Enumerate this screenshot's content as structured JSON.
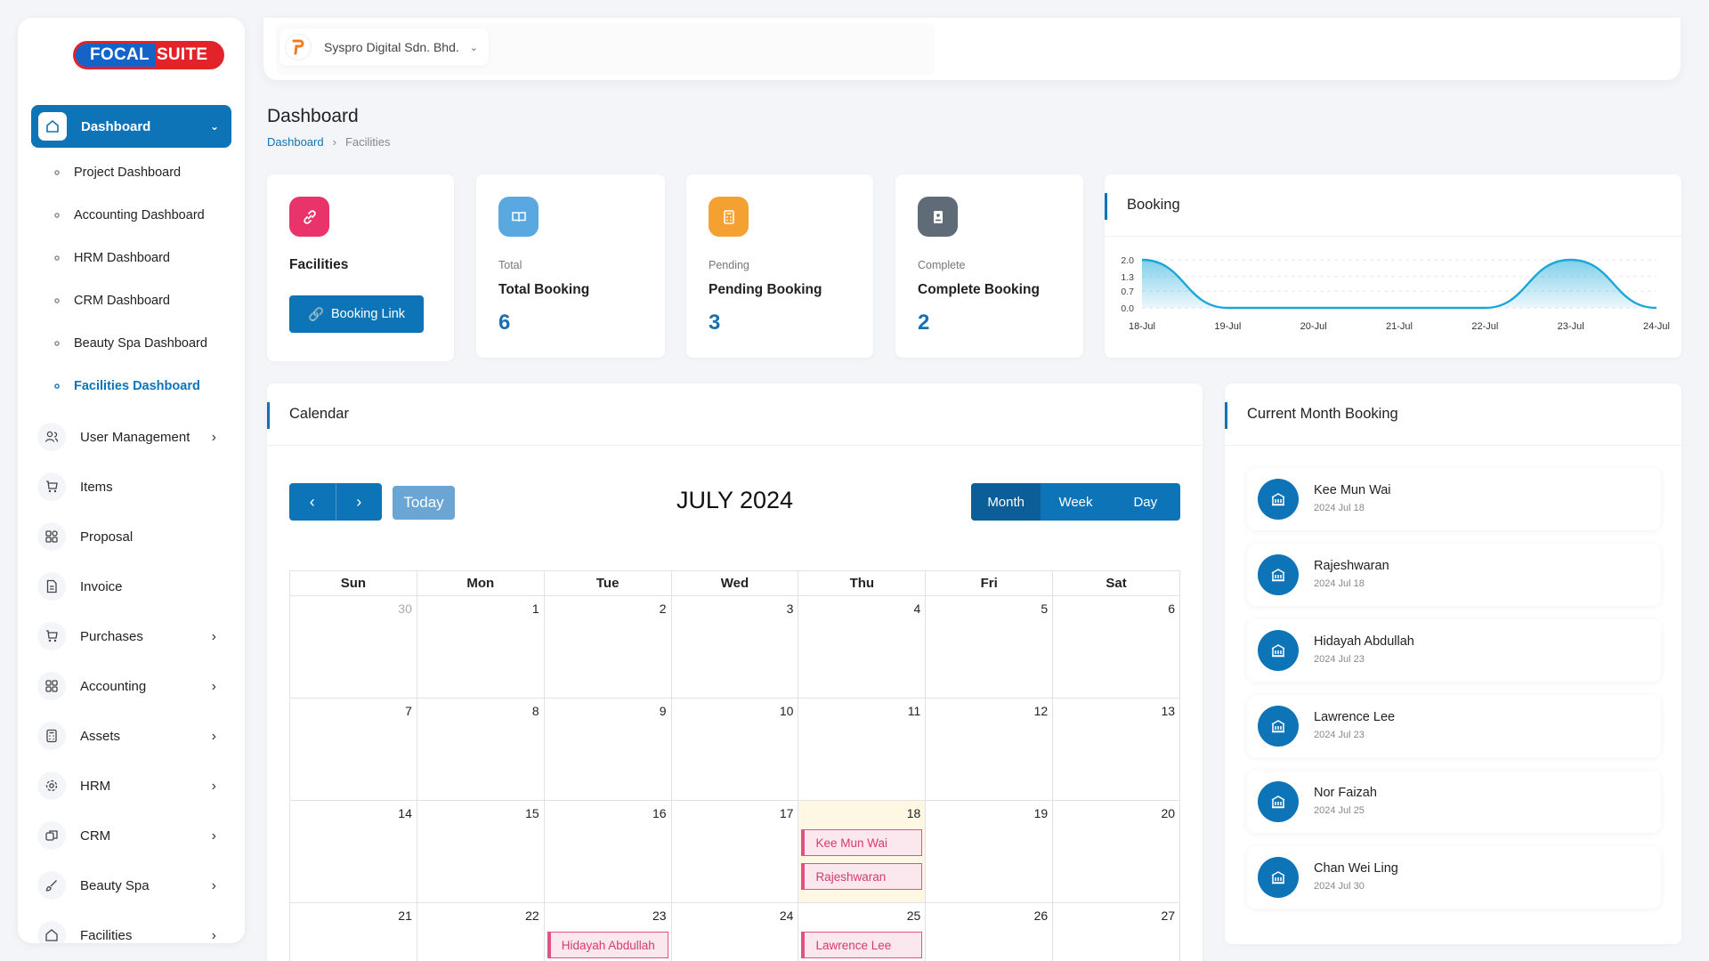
{
  "brand": {
    "logo_part1": "FOCAL",
    "logo_part2": "SUITE"
  },
  "sidebar": {
    "active": {
      "label": "Dashboard"
    },
    "subitems": [
      {
        "label": "Project Dashboard"
      },
      {
        "label": "Accounting Dashboard"
      },
      {
        "label": "HRM Dashboard"
      },
      {
        "label": "CRM Dashboard"
      },
      {
        "label": "Beauty Spa Dashboard"
      },
      {
        "label": "Facilities Dashboard"
      }
    ],
    "items": [
      {
        "label": "User Management",
        "icon": "users-icon"
      },
      {
        "label": "Items",
        "icon": "cart-icon"
      },
      {
        "label": "Proposal",
        "icon": "proposal-icon"
      },
      {
        "label": "Invoice",
        "icon": "invoice-icon"
      },
      {
        "label": "Purchases",
        "icon": "cart-icon"
      },
      {
        "label": "Accounting",
        "icon": "grid-icon"
      },
      {
        "label": "Assets",
        "icon": "calculator-icon"
      },
      {
        "label": "HRM",
        "icon": "hrm-icon"
      },
      {
        "label": "CRM",
        "icon": "crm-icon"
      },
      {
        "label": "Beauty Spa",
        "icon": "brush-icon"
      },
      {
        "label": "Facilities",
        "icon": "home-icon"
      }
    ]
  },
  "header": {
    "company": "Syspro Digital Sdn. Bhd."
  },
  "page": {
    "title": "Dashboard",
    "breadcrumb": [
      "Dashboard",
      "Facilities"
    ]
  },
  "stats": {
    "facilities": {
      "label": "Facilities",
      "button": "Booking Link",
      "color": "#e8336b"
    },
    "total": {
      "small": "Total",
      "label": "Total Booking",
      "value": "6",
      "color": "#5aa8e0"
    },
    "pending": {
      "small": "Pending",
      "label": "Pending Booking",
      "value": "3",
      "color": "#f4a132"
    },
    "complete": {
      "small": "Complete",
      "label": "Complete Booking",
      "value": "2",
      "color": "#5f6b76"
    }
  },
  "booking_chart": {
    "title": "Booking",
    "chart_data": {
      "type": "area",
      "x": [
        "18-Jul",
        "19-Jul",
        "20-Jul",
        "21-Jul",
        "22-Jul",
        "23-Jul",
        "24-Jul"
      ],
      "values": [
        2,
        0,
        0,
        0,
        0,
        2,
        0
      ],
      "yticks": [
        "2.0",
        "1.3",
        "0.7",
        "0.0"
      ],
      "ylim": [
        0,
        2
      ],
      "color": "#1aa7d8"
    }
  },
  "calendar": {
    "title": "Calendar",
    "month_title": "JULY 2024",
    "today_label": "Today",
    "views": [
      "Month",
      "Week",
      "Day"
    ],
    "weekdays": [
      "Sun",
      "Mon",
      "Tue",
      "Wed",
      "Thu",
      "Fri",
      "Sat"
    ],
    "weeks": [
      [
        "30",
        "1",
        "2",
        "3",
        "4",
        "5",
        "6"
      ],
      [
        "7",
        "8",
        "9",
        "10",
        "11",
        "12",
        "13"
      ],
      [
        "14",
        "15",
        "16",
        "17",
        "18",
        "19",
        "20"
      ],
      [
        "21",
        "22",
        "23",
        "24",
        "25",
        "26",
        "27"
      ]
    ],
    "events": [
      {
        "week": 2,
        "day": 4,
        "slot": 0,
        "title": "Kee Mun Wai"
      },
      {
        "week": 2,
        "day": 4,
        "slot": 1,
        "title": "Rajeshwaran"
      },
      {
        "week": 3,
        "day": 2,
        "slot": 0,
        "title": "Hidayah Abdullah"
      },
      {
        "week": 3,
        "day": 4,
        "slot": 0,
        "title": "Lawrence Lee"
      }
    ]
  },
  "current_month": {
    "title": "Current Month Booking",
    "items": [
      {
        "name": "Kee Mun Wai",
        "date": "2024 Jul 18"
      },
      {
        "name": "Rajeshwaran",
        "date": "2024 Jul 18"
      },
      {
        "name": "Hidayah Abdullah",
        "date": "2024 Jul 23"
      },
      {
        "name": "Lawrence Lee",
        "date": "2024 Jul 23"
      },
      {
        "name": "Nor Faizah",
        "date": "2024 Jul 25"
      },
      {
        "name": "Chan Wei Ling",
        "date": "2024 Jul 30"
      }
    ]
  }
}
